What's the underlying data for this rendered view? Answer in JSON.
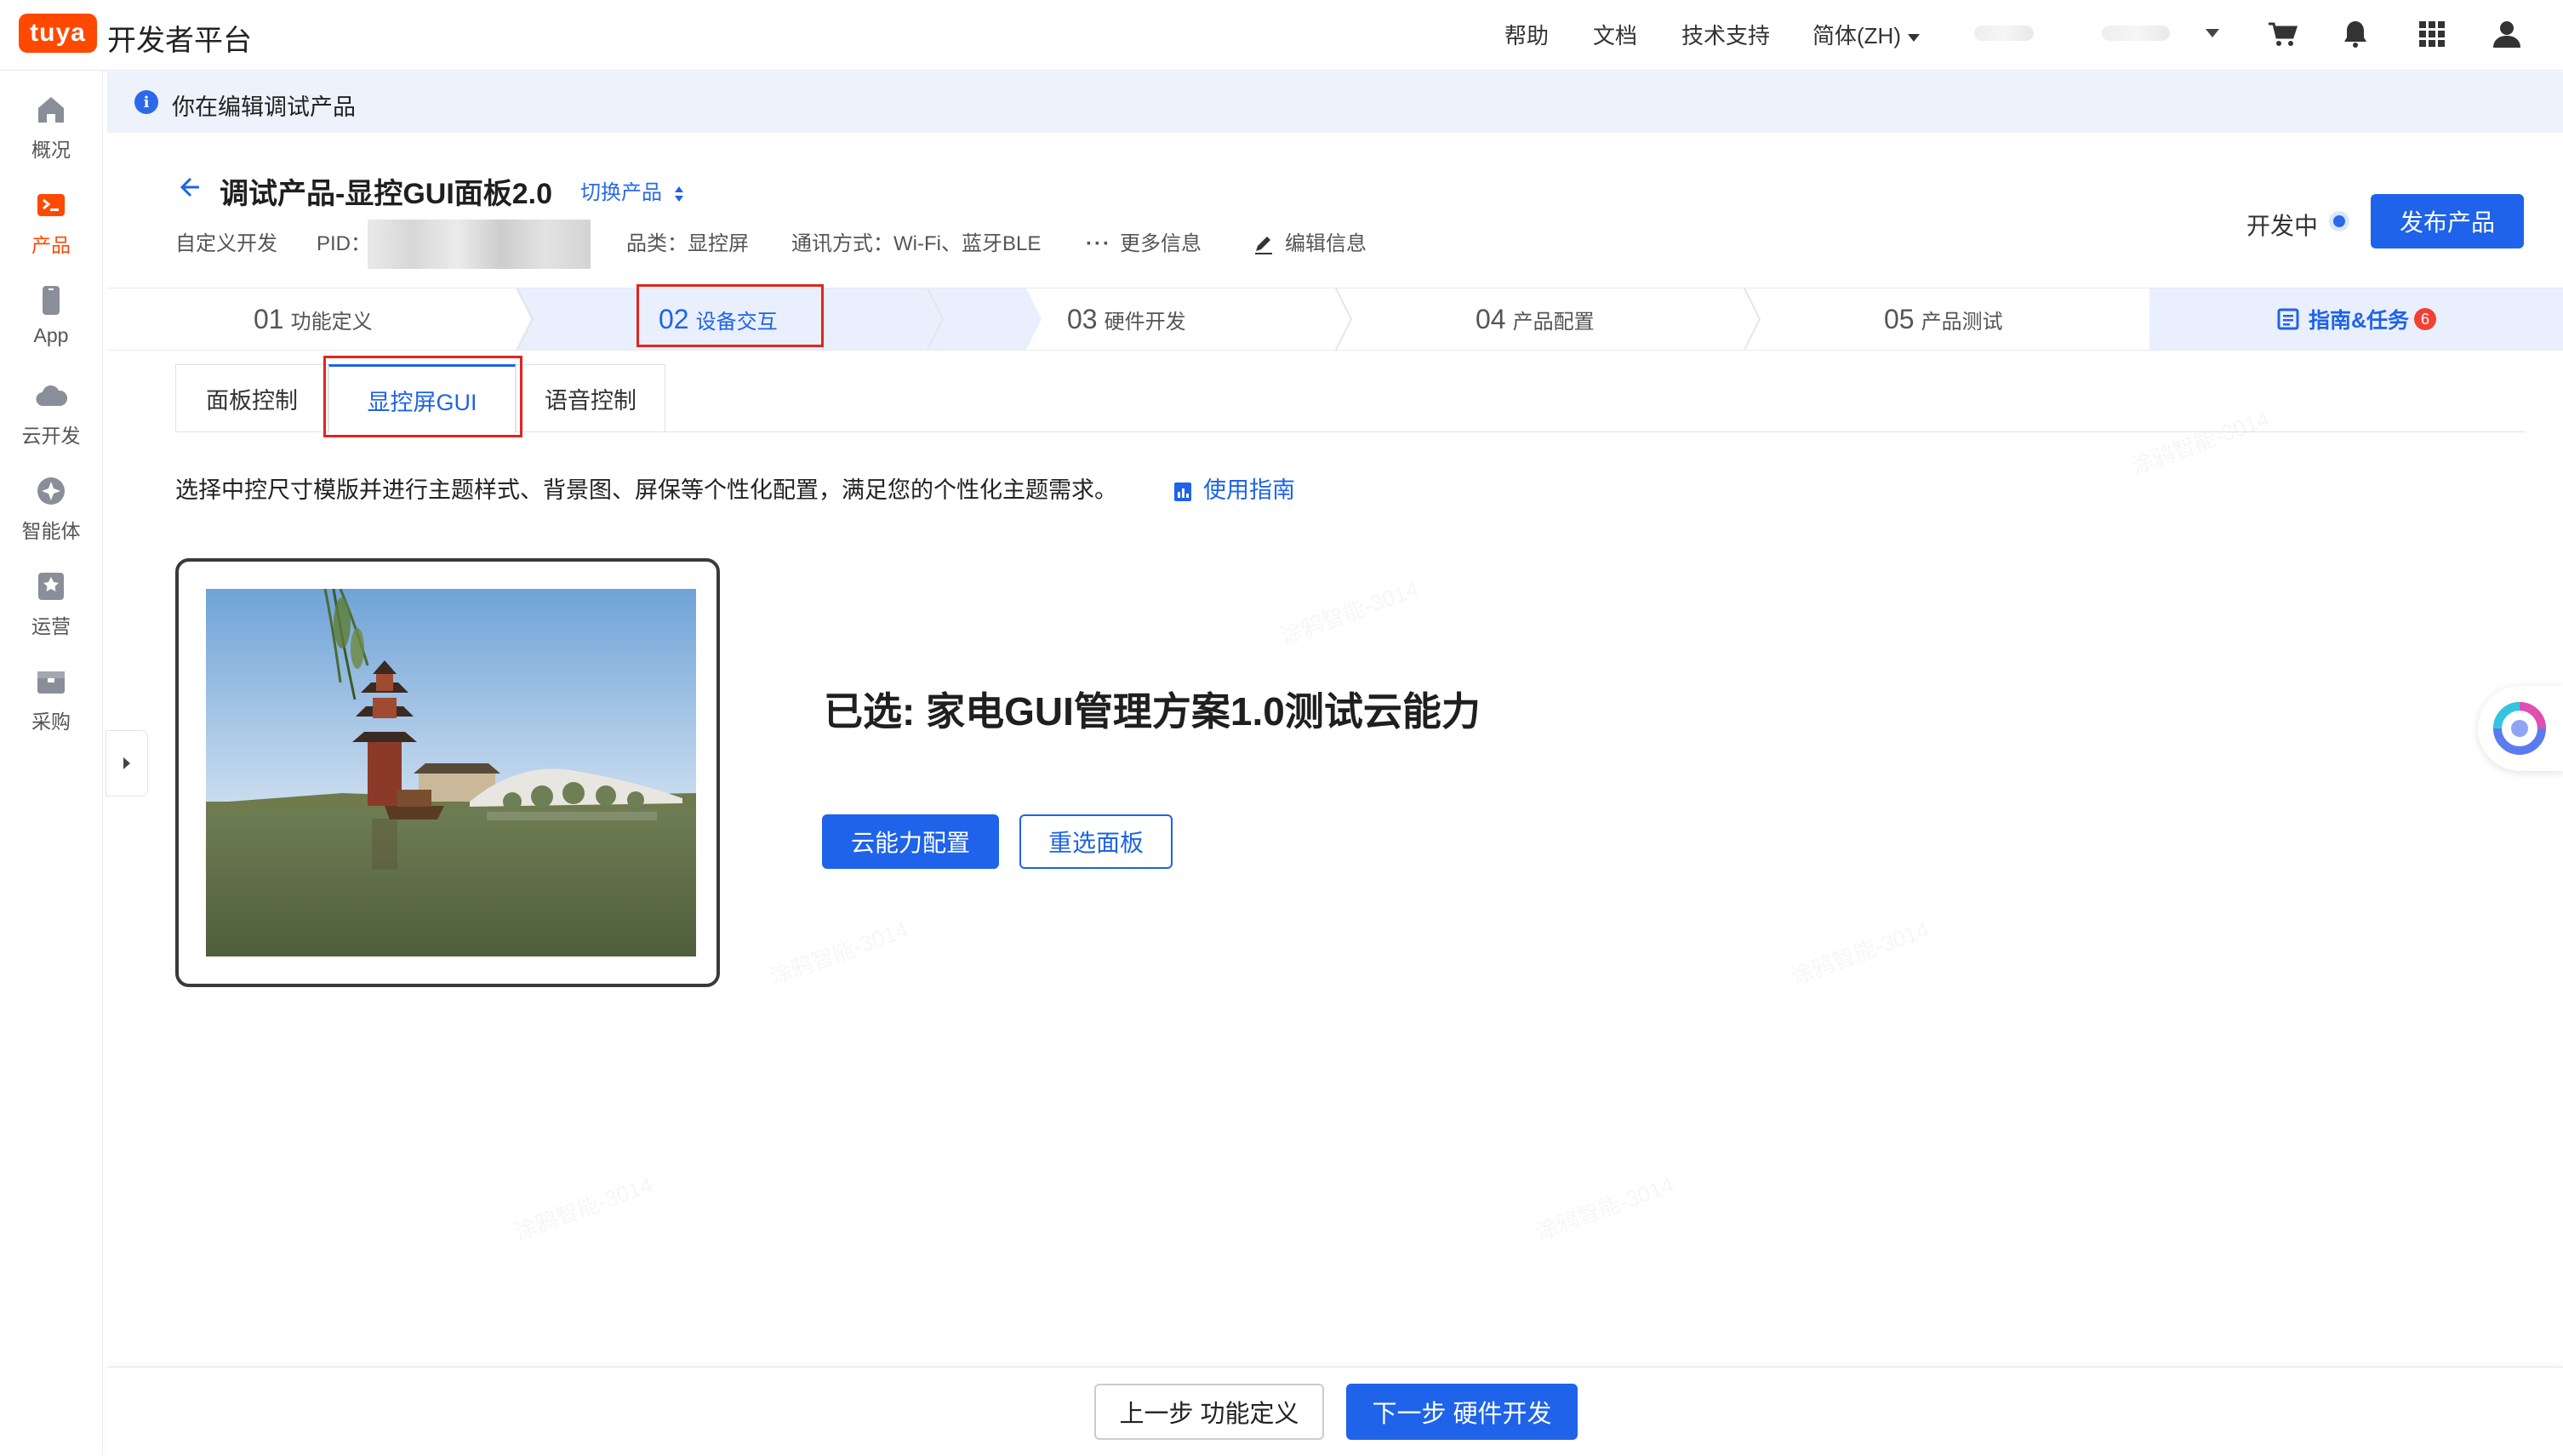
{
  "brand": {
    "logo_text": "tuya",
    "name": "开发者平台"
  },
  "topnav": {
    "help": "帮助",
    "docs": "文档",
    "support": "技术支持",
    "language": "简体(ZH)"
  },
  "sidebar": {
    "items": [
      {
        "label": "概况",
        "icon": "home-icon"
      },
      {
        "label": "产品",
        "icon": "product-icon",
        "active": true
      },
      {
        "label": "App",
        "icon": "phone-icon"
      },
      {
        "label": "云开发",
        "icon": "cloud-icon"
      },
      {
        "label": "智能体",
        "icon": "agent-icon"
      },
      {
        "label": "运营",
        "icon": "star-icon"
      },
      {
        "label": "采购",
        "icon": "box-icon"
      }
    ]
  },
  "banner": {
    "text": "你在编辑调试产品"
  },
  "product": {
    "title": "调试产品-显控GUI面板2.0",
    "switch_label": "切换产品",
    "dev_mode": "自定义开发",
    "pid_label": "PID：",
    "category": "品类：显控屏",
    "comm": "通讯方式：Wi-Fi、蓝牙BLE",
    "more_info": "更多信息",
    "edit_info": "编辑信息",
    "status": "开发中",
    "publish": "发布产品"
  },
  "steps": [
    {
      "num": "01",
      "label": "功能定义"
    },
    {
      "num": "02",
      "label": "设备交互",
      "active": true
    },
    {
      "num": "03",
      "label": "硬件开发"
    },
    {
      "num": "04",
      "label": "产品配置"
    },
    {
      "num": "05",
      "label": "产品测试"
    }
  ],
  "guide": {
    "label": "指南&任务",
    "count": "6"
  },
  "tabs": [
    {
      "label": "面板控制"
    },
    {
      "label": "显控屏GUI",
      "active": true
    },
    {
      "label": "语音控制"
    }
  ],
  "description": "选择中控尺寸模版并进行主题样式、背景图、屏保等个性化配置，满足您的个性化主题需求。",
  "guide_link": "使用指南",
  "selection": {
    "title": "已选: 家电GUI管理方案1.0测试云能力",
    "config_button": "云能力配置",
    "reselect_button": "重选面板"
  },
  "footer": {
    "prev": "上一步 功能定义",
    "next": "下一步 硬件开发"
  },
  "colors": {
    "accent": "#1e63e9",
    "brand": "#ff4800",
    "highlight": "#e0261c"
  }
}
